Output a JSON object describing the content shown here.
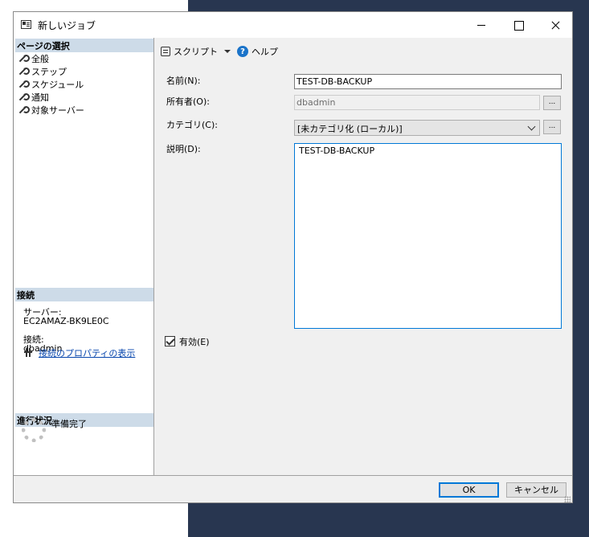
{
  "window": {
    "title": "新しいジョブ"
  },
  "left_panel": {
    "pages_header": "ページの選択",
    "pages": [
      "全般",
      "ステップ",
      "スケジュール",
      "通知",
      "対象サーバー"
    ],
    "connection_header": "接続",
    "server_label": "サーバー:",
    "server_value": "EC2AMAZ-BK9LE0C",
    "connection_label": "接続:",
    "connection_value": "dbadmin",
    "connection_link": "接続のプロパティの表示",
    "progress_header": "進行状況",
    "progress_status": "準備完了"
  },
  "toolbar": {
    "script_label": "スクリプト",
    "help_label": "ヘルプ"
  },
  "form": {
    "name_label": "名前(N):",
    "name_value": "TEST-DB-BACKUP",
    "owner_label": "所有者(O):",
    "owner_value": "dbadmin",
    "category_label": "カテゴリ(C):",
    "category_value": "[未カテゴリ化 (ローカル)]",
    "description_label": "説明(D):",
    "description_value": "TEST-DB-BACKUP",
    "enabled_label": "有効(E)",
    "enabled": true,
    "ellipsis": "..."
  },
  "buttons": {
    "ok": "OK",
    "cancel": "キャンセル"
  }
}
